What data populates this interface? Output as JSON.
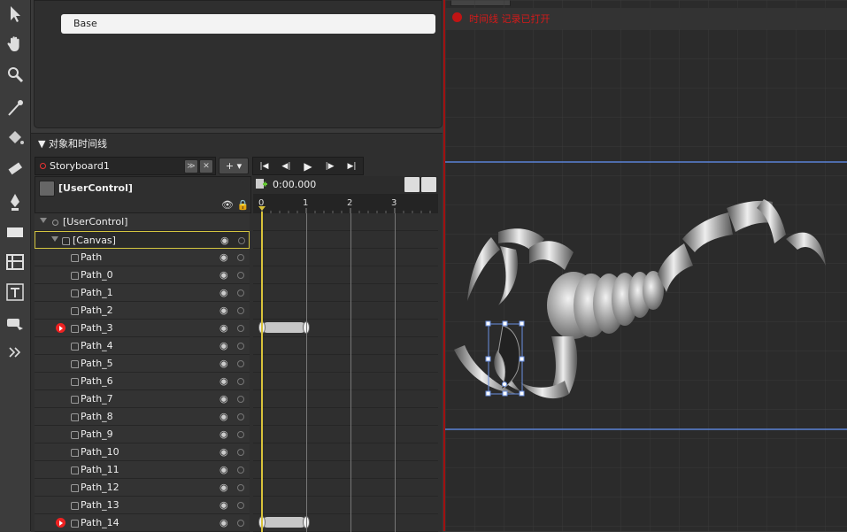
{
  "states": {
    "base_label": "Base"
  },
  "objects_panel": {
    "title": "▼ 对象和时间线",
    "storyboard": "Storyboard1",
    "add_label": "+ ▾",
    "transport": {
      "first": "|◀",
      "prev": "◀|",
      "play": "▶",
      "next": "|▶",
      "last": "▶|"
    },
    "user_control_header": "[UserControl]",
    "time": "0:00.000",
    "ruler_ticks": [
      "0",
      "1",
      "2",
      "3"
    ],
    "tree": [
      {
        "label": "[UserControl]",
        "level": 0,
        "expandable": true,
        "keys": false
      },
      {
        "label": "[Canvas]",
        "level": 1,
        "expandable": true,
        "selected": true,
        "keys": false
      },
      {
        "label": "Path",
        "level": 2,
        "keys": false
      },
      {
        "label": "Path_0",
        "level": 2,
        "keys": false
      },
      {
        "label": "Path_1",
        "level": 2,
        "keys": false
      },
      {
        "label": "Path_2",
        "level": 2,
        "keys": false
      },
      {
        "label": "Path_3",
        "level": 2,
        "keys": true
      },
      {
        "label": "Path_4",
        "level": 2,
        "keys": false
      },
      {
        "label": "Path_5",
        "level": 2,
        "keys": false
      },
      {
        "label": "Path_6",
        "level": 2,
        "keys": false
      },
      {
        "label": "Path_7",
        "level": 2,
        "keys": false
      },
      {
        "label": "Path_8",
        "level": 2,
        "keys": false
      },
      {
        "label": "Path_9",
        "level": 2,
        "keys": false
      },
      {
        "label": "Path_10",
        "level": 2,
        "keys": false
      },
      {
        "label": "Path_11",
        "level": 2,
        "keys": false
      },
      {
        "label": "Path_12",
        "level": 2,
        "keys": false
      },
      {
        "label": "Path_13",
        "level": 2,
        "keys": false
      },
      {
        "label": "Path_14",
        "level": 2,
        "keys": true
      }
    ]
  },
  "artboard": {
    "recording_text": "时间线 记录已打开"
  },
  "tools": [
    "selection-arrow-icon",
    "pan-hand-icon",
    "zoom-icon",
    "eyedropper-icon",
    "paint-bucket-icon",
    "eraser-icon",
    "pen-icon",
    "rectangle-icon",
    "grid-layout-icon",
    "text-tool-icon",
    "assets-icon",
    "more-tools-icon"
  ],
  "colors": {
    "accent_recording": "#d41a1a",
    "selection_outline": "#d4c540",
    "playhead": "#d9c23a"
  }
}
